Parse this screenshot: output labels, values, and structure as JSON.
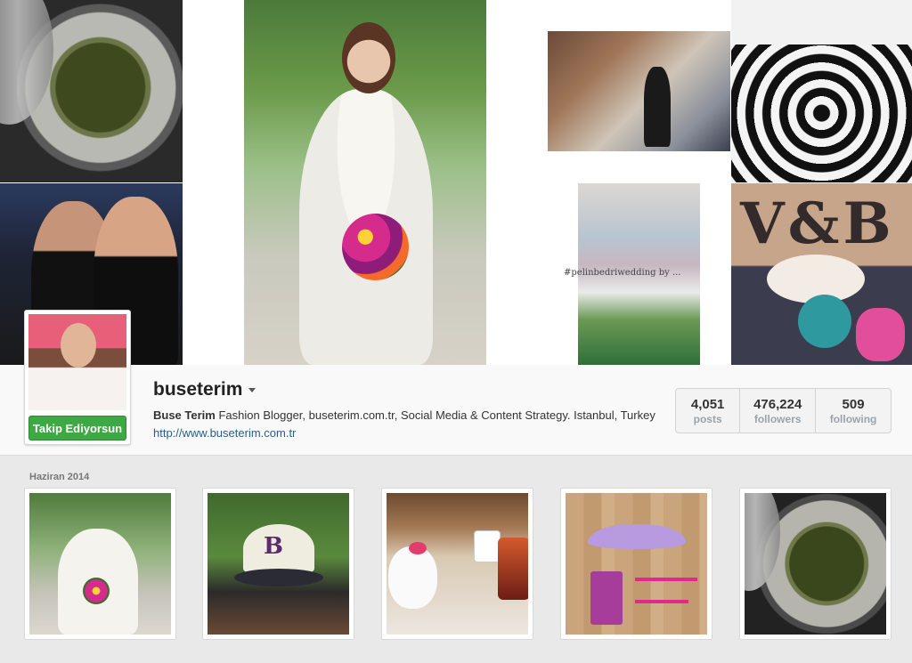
{
  "profile": {
    "username": "buseterim",
    "full_name": "Buse Terim",
    "bio": " Fashion Blogger, buseterim.com.tr, Social Media & Content Strategy. Istanbul, Turkey ",
    "website": "http://www.buseterim.com.tr",
    "follow_button_label": "Takip Ediyorsun"
  },
  "stats": {
    "posts_count": "4,051",
    "posts_label": "posts",
    "followers_count": "476,224",
    "followers_label": "followers",
    "following_count": "509",
    "following_label": "following"
  },
  "collage": {
    "ceremony_caption": "#pelinbedriwedding by ..."
  },
  "feed": {
    "month_label": "Haziran 2014"
  },
  "colors": {
    "follow_green": "#3da844",
    "link_blue": "#275e8e",
    "background": "#e9e9e9"
  },
  "icons": {
    "username_menu": "caret-down-icon"
  }
}
